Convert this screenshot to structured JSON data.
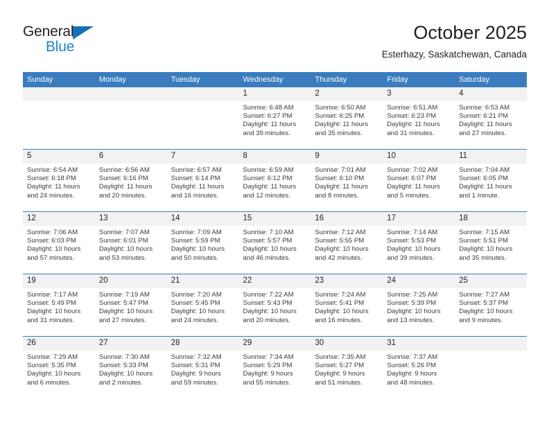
{
  "logo": {
    "text_top": "General",
    "text_bottom": "Blue",
    "color_dark": "#231f20",
    "color_blue": "#1b84c6",
    "triangle_color": "#1271b9"
  },
  "header": {
    "month_title": "October 2025",
    "location": "Esterhazy, Saskatchewan, Canada"
  },
  "theme": {
    "header_row_bg": "#3a7cbe",
    "header_row_text": "#ffffff",
    "daynum_bg": "#f2f2f2",
    "body_text": "#3a3a3a",
    "week_separator": "#3a7cbe"
  },
  "weekday_headers": [
    "Sunday",
    "Monday",
    "Tuesday",
    "Wednesday",
    "Thursday",
    "Friday",
    "Saturday"
  ],
  "weeks": [
    [
      {
        "day": "",
        "empty": true,
        "sunrise": "",
        "sunset": "",
        "daylight1": "",
        "daylight2": ""
      },
      {
        "day": "",
        "empty": true,
        "sunrise": "",
        "sunset": "",
        "daylight1": "",
        "daylight2": ""
      },
      {
        "day": "",
        "empty": true,
        "sunrise": "",
        "sunset": "",
        "daylight1": "",
        "daylight2": ""
      },
      {
        "day": "1",
        "empty": false,
        "sunrise": "Sunrise: 6:48 AM",
        "sunset": "Sunset: 6:27 PM",
        "daylight1": "Daylight: 11 hours",
        "daylight2": "and 39 minutes."
      },
      {
        "day": "2",
        "empty": false,
        "sunrise": "Sunrise: 6:50 AM",
        "sunset": "Sunset: 6:25 PM",
        "daylight1": "Daylight: 11 hours",
        "daylight2": "and 35 minutes."
      },
      {
        "day": "3",
        "empty": false,
        "sunrise": "Sunrise: 6:51 AM",
        "sunset": "Sunset: 6:23 PM",
        "daylight1": "Daylight: 11 hours",
        "daylight2": "and 31 minutes."
      },
      {
        "day": "4",
        "empty": false,
        "sunrise": "Sunrise: 6:53 AM",
        "sunset": "Sunset: 6:21 PM",
        "daylight1": "Daylight: 11 hours",
        "daylight2": "and 27 minutes."
      }
    ],
    [
      {
        "day": "5",
        "empty": false,
        "sunrise": "Sunrise: 6:54 AM",
        "sunset": "Sunset: 6:18 PM",
        "daylight1": "Daylight: 11 hours",
        "daylight2": "and 24 minutes."
      },
      {
        "day": "6",
        "empty": false,
        "sunrise": "Sunrise: 6:56 AM",
        "sunset": "Sunset: 6:16 PM",
        "daylight1": "Daylight: 11 hours",
        "daylight2": "and 20 minutes."
      },
      {
        "day": "7",
        "empty": false,
        "sunrise": "Sunrise: 6:57 AM",
        "sunset": "Sunset: 6:14 PM",
        "daylight1": "Daylight: 11 hours",
        "daylight2": "and 16 minutes."
      },
      {
        "day": "8",
        "empty": false,
        "sunrise": "Sunrise: 6:59 AM",
        "sunset": "Sunset: 6:12 PM",
        "daylight1": "Daylight: 11 hours",
        "daylight2": "and 12 minutes."
      },
      {
        "day": "9",
        "empty": false,
        "sunrise": "Sunrise: 7:01 AM",
        "sunset": "Sunset: 6:10 PM",
        "daylight1": "Daylight: 11 hours",
        "daylight2": "and 8 minutes."
      },
      {
        "day": "10",
        "empty": false,
        "sunrise": "Sunrise: 7:02 AM",
        "sunset": "Sunset: 6:07 PM",
        "daylight1": "Daylight: 11 hours",
        "daylight2": "and 5 minutes."
      },
      {
        "day": "11",
        "empty": false,
        "sunrise": "Sunrise: 7:04 AM",
        "sunset": "Sunset: 6:05 PM",
        "daylight1": "Daylight: 11 hours",
        "daylight2": "and 1 minute."
      }
    ],
    [
      {
        "day": "12",
        "empty": false,
        "sunrise": "Sunrise: 7:06 AM",
        "sunset": "Sunset: 6:03 PM",
        "daylight1": "Daylight: 10 hours",
        "daylight2": "and 57 minutes."
      },
      {
        "day": "13",
        "empty": false,
        "sunrise": "Sunrise: 7:07 AM",
        "sunset": "Sunset: 6:01 PM",
        "daylight1": "Daylight: 10 hours",
        "daylight2": "and 53 minutes."
      },
      {
        "day": "14",
        "empty": false,
        "sunrise": "Sunrise: 7:09 AM",
        "sunset": "Sunset: 5:59 PM",
        "daylight1": "Daylight: 10 hours",
        "daylight2": "and 50 minutes."
      },
      {
        "day": "15",
        "empty": false,
        "sunrise": "Sunrise: 7:10 AM",
        "sunset": "Sunset: 5:57 PM",
        "daylight1": "Daylight: 10 hours",
        "daylight2": "and 46 minutes."
      },
      {
        "day": "16",
        "empty": false,
        "sunrise": "Sunrise: 7:12 AM",
        "sunset": "Sunset: 5:55 PM",
        "daylight1": "Daylight: 10 hours",
        "daylight2": "and 42 minutes."
      },
      {
        "day": "17",
        "empty": false,
        "sunrise": "Sunrise: 7:14 AM",
        "sunset": "Sunset: 5:53 PM",
        "daylight1": "Daylight: 10 hours",
        "daylight2": "and 39 minutes."
      },
      {
        "day": "18",
        "empty": false,
        "sunrise": "Sunrise: 7:15 AM",
        "sunset": "Sunset: 5:51 PM",
        "daylight1": "Daylight: 10 hours",
        "daylight2": "and 35 minutes."
      }
    ],
    [
      {
        "day": "19",
        "empty": false,
        "sunrise": "Sunrise: 7:17 AM",
        "sunset": "Sunset: 5:49 PM",
        "daylight1": "Daylight: 10 hours",
        "daylight2": "and 31 minutes."
      },
      {
        "day": "20",
        "empty": false,
        "sunrise": "Sunrise: 7:19 AM",
        "sunset": "Sunset: 5:47 PM",
        "daylight1": "Daylight: 10 hours",
        "daylight2": "and 27 minutes."
      },
      {
        "day": "21",
        "empty": false,
        "sunrise": "Sunrise: 7:20 AM",
        "sunset": "Sunset: 5:45 PM",
        "daylight1": "Daylight: 10 hours",
        "daylight2": "and 24 minutes."
      },
      {
        "day": "22",
        "empty": false,
        "sunrise": "Sunrise: 7:22 AM",
        "sunset": "Sunset: 5:43 PM",
        "daylight1": "Daylight: 10 hours",
        "daylight2": "and 20 minutes."
      },
      {
        "day": "23",
        "empty": false,
        "sunrise": "Sunrise: 7:24 AM",
        "sunset": "Sunset: 5:41 PM",
        "daylight1": "Daylight: 10 hours",
        "daylight2": "and 16 minutes."
      },
      {
        "day": "24",
        "empty": false,
        "sunrise": "Sunrise: 7:25 AM",
        "sunset": "Sunset: 5:39 PM",
        "daylight1": "Daylight: 10 hours",
        "daylight2": "and 13 minutes."
      },
      {
        "day": "25",
        "empty": false,
        "sunrise": "Sunrise: 7:27 AM",
        "sunset": "Sunset: 5:37 PM",
        "daylight1": "Daylight: 10 hours",
        "daylight2": "and 9 minutes."
      }
    ],
    [
      {
        "day": "26",
        "empty": false,
        "sunrise": "Sunrise: 7:29 AM",
        "sunset": "Sunset: 5:35 PM",
        "daylight1": "Daylight: 10 hours",
        "daylight2": "and 6 minutes."
      },
      {
        "day": "27",
        "empty": false,
        "sunrise": "Sunrise: 7:30 AM",
        "sunset": "Sunset: 5:33 PM",
        "daylight1": "Daylight: 10 hours",
        "daylight2": "and 2 minutes."
      },
      {
        "day": "28",
        "empty": false,
        "sunrise": "Sunrise: 7:32 AM",
        "sunset": "Sunset: 5:31 PM",
        "daylight1": "Daylight: 9 hours",
        "daylight2": "and 59 minutes."
      },
      {
        "day": "29",
        "empty": false,
        "sunrise": "Sunrise: 7:34 AM",
        "sunset": "Sunset: 5:29 PM",
        "daylight1": "Daylight: 9 hours",
        "daylight2": "and 55 minutes."
      },
      {
        "day": "30",
        "empty": false,
        "sunrise": "Sunrise: 7:35 AM",
        "sunset": "Sunset: 5:27 PM",
        "daylight1": "Daylight: 9 hours",
        "daylight2": "and 51 minutes."
      },
      {
        "day": "31",
        "empty": false,
        "sunrise": "Sunrise: 7:37 AM",
        "sunset": "Sunset: 5:26 PM",
        "daylight1": "Daylight: 9 hours",
        "daylight2": "and 48 minutes."
      },
      {
        "day": "",
        "empty": true,
        "sunrise": "",
        "sunset": "",
        "daylight1": "",
        "daylight2": ""
      }
    ]
  ]
}
